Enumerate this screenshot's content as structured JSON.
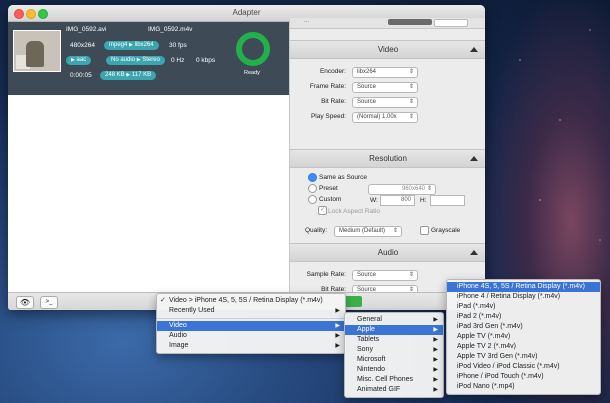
{
  "window": {
    "title": "Adapter"
  },
  "file": {
    "source_name": "IMG_0592.avi",
    "target_name": "IMG_0592.m4v",
    "resolution": "480x264",
    "codec": "mpeg4",
    "target_codec": "libx264",
    "fps": "30 fps",
    "audio_codec": "aac",
    "no_audio": "No audio",
    "stereo": "Stereo",
    "hz": "0 Hz",
    "kbps": "0 kbps",
    "duration": "0:00:05",
    "size_from": "248 KB",
    "size_to": "117 KB",
    "status": "Ready",
    "progress": 1.0,
    "progress_color": "#22b04b"
  },
  "output_path_stub": "...",
  "video": {
    "header": "Video",
    "encoder_label": "Encoder:",
    "encoder_value": "libx264",
    "frame_rate_label": "Frame Rate:",
    "frame_rate_value": "Source",
    "bit_rate_label": "Bit Rate:",
    "bit_rate_value": "Source",
    "play_speed_label": "Play Speed:",
    "play_speed_value": "(Normal) 1.00x"
  },
  "resolution": {
    "header": "Resolution",
    "same_as_source": "Same as Source",
    "preset": "Preset",
    "preset_value": "960x640",
    "custom": "Custom",
    "w_label": "W:",
    "w_value": "800",
    "h_label": "H:",
    "h_value": "",
    "lock_aspect": "Lock Aspect Ratio",
    "quality_label": "Quality:",
    "quality_value": "Medium (Default)",
    "grayscale": "Grayscale"
  },
  "audio": {
    "header": "Audio",
    "sample_rate_label": "Sample Rate:",
    "sample_rate_value": "Source",
    "bit_rate_label": "Bit Rate:",
    "bit_rate_value": "Source"
  },
  "menu1": {
    "checked": "Video > iPhone 4S, 5, 5S / Retina Display (*.m4v)",
    "recent": "Recently Used",
    "items": [
      "Video",
      "Audio",
      "Image"
    ]
  },
  "menu2": {
    "items": [
      "General",
      "Apple",
      "Tablets",
      "Sony",
      "Microsoft",
      "Nintendo",
      "Misc. Cell Phones",
      "Animated GIF"
    ]
  },
  "menu3": {
    "items": [
      "iPhone 4S, 5, 5S / Retina Display (*.m4v)",
      "iPhone 4 / Retina Display (*.m4v)",
      "iPad (*.m4v)",
      "iPad 2 (*.m4v)",
      "iPad 3rd Gen (*.m4v)",
      "Apple TV (*.m4v)",
      "Apple TV 2 (*.m4v)",
      "Apple TV 3rd Gen (*.m4v)",
      "iPod Video / iPod Classic (*.m4v)",
      "iPhone / iPod Touch (*.m4v)",
      "iPod Nano (*.mp4)"
    ]
  },
  "colors": {
    "accent": "#3aa6b0",
    "highlight": "#3a75d6",
    "ready_green": "#22b04b"
  }
}
